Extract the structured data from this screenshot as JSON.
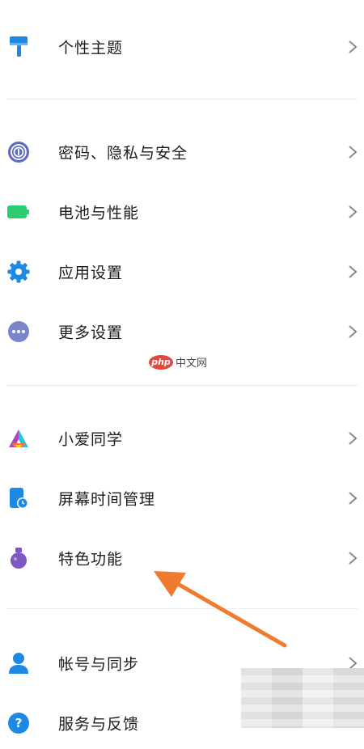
{
  "settings": {
    "items": [
      {
        "label": "个性主题",
        "icon": "paint-roller-icon",
        "color": "#1e88e5"
      },
      {
        "label": "密码、隐私与安全",
        "icon": "fingerprint-icon",
        "color": "#5c6bc0"
      },
      {
        "label": "电池与性能",
        "icon": "battery-icon",
        "color": "#2ecc71"
      },
      {
        "label": "应用设置",
        "icon": "gear-icon",
        "color": "#1e88e5"
      },
      {
        "label": "更多设置",
        "icon": "more-dots-icon",
        "color": "#7986cb"
      },
      {
        "label": "小爱同学",
        "icon": "xiaoai-icon",
        "color": "#e91e63"
      },
      {
        "label": "屏幕时间管理",
        "icon": "screen-time-icon",
        "color": "#1e88e5"
      },
      {
        "label": "特色功能",
        "icon": "flask-icon",
        "color": "#7e57c2"
      },
      {
        "label": "帐号与同步",
        "icon": "user-icon",
        "color": "#1e88e5"
      },
      {
        "label": "服务与反馈",
        "icon": "help-icon",
        "color": "#1e88e5"
      }
    ]
  },
  "watermark": {
    "brand": "php",
    "text": "中文网"
  },
  "colors": {
    "arrow": "#f07a2e",
    "divider": "#ececec",
    "chevron": "#8a8a8a"
  }
}
